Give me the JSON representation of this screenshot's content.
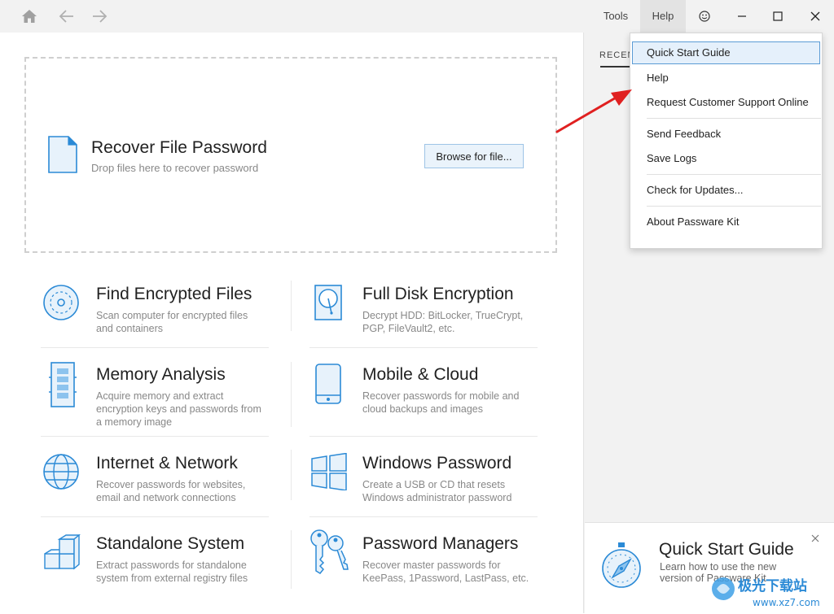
{
  "titlebar": {
    "menu_tools": "Tools",
    "menu_help": "Help"
  },
  "dropzone": {
    "title": "Recover File Password",
    "subtitle": "Drop files here to recover password",
    "browse_label": "Browse for file..."
  },
  "tiles": [
    {
      "title": "Find Encrypted Files",
      "desc": "Scan computer for encrypted files and containers",
      "icon": "disc-search-icon"
    },
    {
      "title": "Full Disk Encryption",
      "desc": "Decrypt HDD: BitLocker, TrueCrypt, PGP, FileVault2, etc.",
      "icon": "hard-disk-icon"
    },
    {
      "title": "Memory Analysis",
      "desc": "Acquire memory and extract encryption keys and passwords from a memory image",
      "icon": "memory-chip-icon"
    },
    {
      "title": "Mobile & Cloud",
      "desc": "Recover passwords for mobile and cloud backups and images",
      "icon": "mobile-phone-icon"
    },
    {
      "title": "Internet & Network",
      "desc": "Recover passwords for websites, email and network connections",
      "icon": "globe-icon"
    },
    {
      "title": "Windows Password",
      "desc": "Create a USB or CD that resets Windows administrator password",
      "icon": "windows-logo-icon"
    },
    {
      "title": "Standalone System",
      "desc": "Extract passwords for standalone system from external registry files",
      "icon": "cubes-icon"
    },
    {
      "title": "Password Managers",
      "desc": "Recover master passwords for KeePass, 1Password, LastPass, etc.",
      "icon": "keys-icon"
    }
  ],
  "right_pane": {
    "recent_tab": "RECEN",
    "quickstart_title": "Quick Start Guide",
    "quickstart_desc": "Learn how to use the new version of Passware Kit"
  },
  "help_menu": {
    "items": [
      "Quick Start Guide",
      "Help",
      "Request Customer Support Online",
      "Send Feedback",
      "Save Logs",
      "Check for Updates...",
      "About Passware Kit"
    ]
  },
  "colors": {
    "accent": "#2b8ad6",
    "arrow": "#e02020",
    "highlight_border": "#5b9bd5"
  },
  "watermark": {
    "text": "极光下载站",
    "url": "www.xz7.com"
  }
}
